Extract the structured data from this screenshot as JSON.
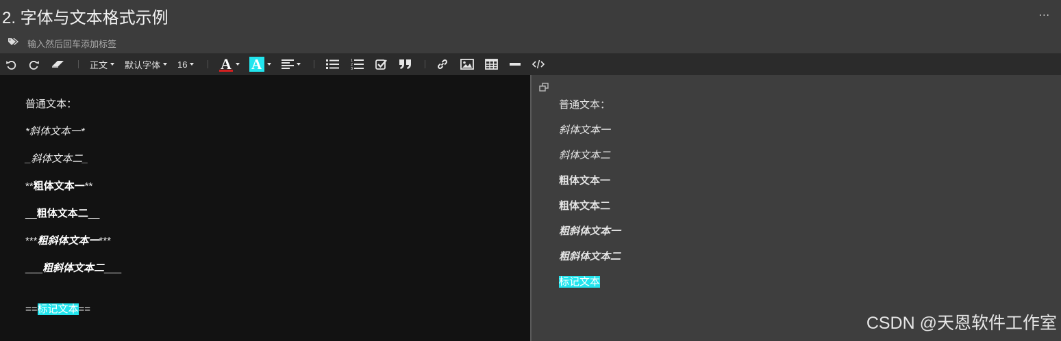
{
  "title": "2. 字体与文本格式示例",
  "more": "...",
  "tag_placeholder": "输入然后回车添加标签",
  "toolbar": {
    "paragraph": "正文",
    "font": "默认字体",
    "size": "16",
    "font_color_glyph": "A",
    "bg_color_glyph": "A",
    "highlight_color": "#22e5ee",
    "font_color_underline": "#d42020"
  },
  "icons": {
    "undo": "undo-icon",
    "redo": "redo-icon",
    "eraser": "eraser-icon",
    "align": "align-left-icon",
    "bullet": "bullet-list-icon",
    "ordered": "ordered-list-icon",
    "task": "task-list-icon",
    "quote": "quote-icon",
    "link": "link-icon",
    "image": "image-icon",
    "table": "table-icon",
    "hr": "horizontal-rule-icon",
    "code": "code-icon",
    "tag": "tag-icon",
    "copy": "copy-icon"
  },
  "editor": {
    "l1": "普通文本：",
    "l2a": "*",
    "l2b": "斜体文本一",
    "l2c": "*",
    "l3a": "_",
    "l3b": "斜体文本二",
    "l3c": "_",
    "l4a": "**",
    "l4b": "粗体文本一",
    "l4c": "**",
    "l5a": "__",
    "l5b": "粗体文本二",
    "l5c": "__",
    "l6a": "***",
    "l6b": "粗斜体文本一",
    "l6c": "***",
    "l7a": "___",
    "l7b": "粗斜体文本二",
    "l7c": "___",
    "l8a": "==",
    "l8b": "标记文本",
    "l8c": "=="
  },
  "preview": {
    "p1": "普通文本：",
    "p2": "斜体文本一",
    "p3": "斜体文本二",
    "p4": "粗体文本一",
    "p5": "粗体文本二",
    "p6": "粗斜体文本一",
    "p7": "粗斜体文本二",
    "p8": "标记文本"
  },
  "watermark": "CSDN @天恩软件工作室"
}
